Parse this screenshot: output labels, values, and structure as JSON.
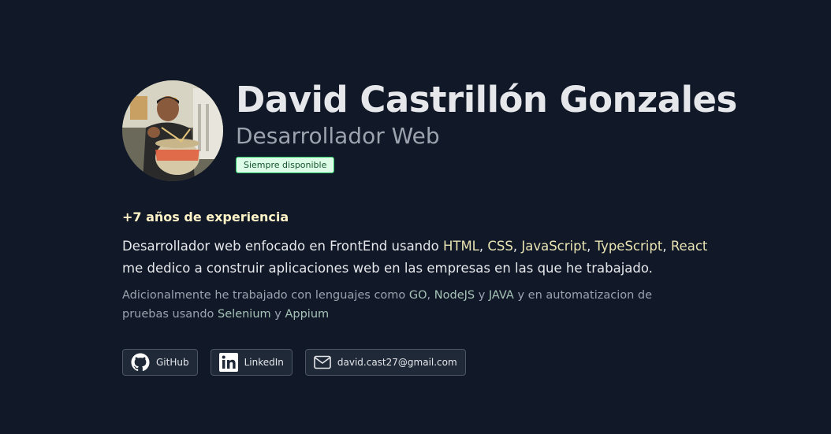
{
  "profile": {
    "name": "David Castrillón Gonzales",
    "role": "Desarrollador Web",
    "status_badge": "Siempre disponible"
  },
  "experience": "+7 años de experiencia",
  "bio": {
    "p1_a": "Desarrollador web enfocado en FrontEnd usando ",
    "tech1": "HTML",
    "sep1": ", ",
    "tech2": "CSS",
    "sep2": ", ",
    "tech3": "JavaScript",
    "sep3": ", ",
    "tech4": "TypeScript",
    "sep4": ", ",
    "tech5": "React",
    "p1_b": " me dedico a construir aplicaciones web en las empresas en las que he trabajado."
  },
  "bio2": {
    "a": "Adicionalmente he trabajado con lenguajes como ",
    "lang1": "GO",
    "sep1": ", ",
    "lang2": "NodeJS",
    "sep2": " y ",
    "lang3": "JAVA",
    "b": " y en automatizacion de pruebas usando ",
    "tool1": "Selenium",
    "sep3": " y ",
    "tool2": "Appium"
  },
  "links": {
    "github": {
      "label": "GitHub",
      "icon": "github-icon"
    },
    "linkedin": {
      "label": "LinkedIn",
      "icon": "linkedin-icon"
    },
    "email": {
      "label": "david.cast27@gmail.com",
      "icon": "mail-icon"
    }
  },
  "colors": {
    "background": "#111827",
    "highlight": "#e9e4b3",
    "badge_bg": "#dcfce7",
    "badge_border": "#22c55e"
  }
}
